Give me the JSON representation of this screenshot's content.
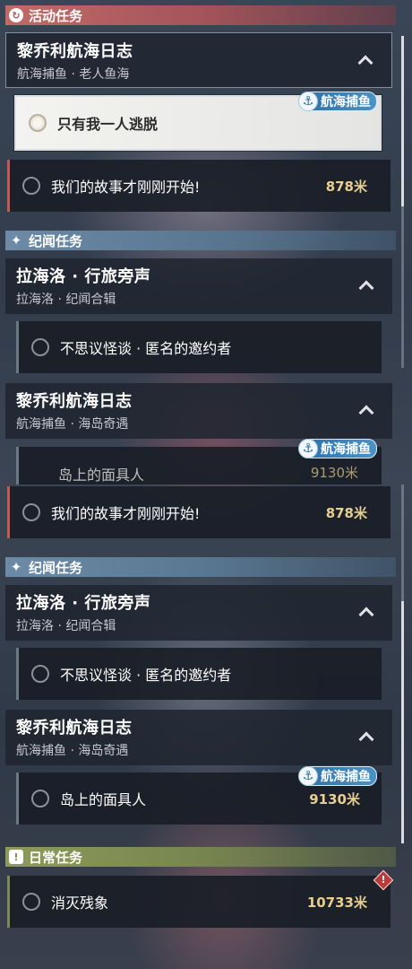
{
  "colors": {
    "activity_header": "#b0585a",
    "lore_header": "#5a7892",
    "daily_header": "#7d8b4e",
    "distance_text": "#e8cf8f",
    "badge_blue": "#3a82b8",
    "alert_red": "#b83c3c"
  },
  "panel_a": {
    "activity_header": {
      "label": "活动任务",
      "icon": "cycle-icon"
    },
    "activity_chapter": {
      "title": "黎乔利航海日志",
      "subtitle": "航海捕鱼 · 老人鱼海"
    },
    "selected_task": {
      "label": "只有我一人逃脱",
      "badge": "航海捕鱼"
    },
    "task_story": {
      "label": "我们的故事才刚刚开始!",
      "distance": "878米"
    },
    "lore_header": {
      "label": "纪闻任务",
      "icon": "sparkle-icon"
    },
    "lore_chapter_1": {
      "title": "拉海洛 · 行旅旁声",
      "subtitle": "拉海洛 · 纪闻合辑"
    },
    "task_inviter": {
      "label": "不思议怪谈 · 匿名的邀约者"
    },
    "lore_chapter_2": {
      "title": "黎乔利航海日志",
      "subtitle": "航海捕鱼 · 海岛奇遇"
    },
    "cut_task": {
      "label": "岛上的面具人",
      "distance": "9130米",
      "badge": "航海捕鱼"
    }
  },
  "panel_b": {
    "task_story": {
      "label": "我们的故事才刚刚开始!",
      "distance": "878米"
    },
    "lore_header": {
      "label": "纪闻任务",
      "icon": "sparkle-icon"
    },
    "lore_chapter_1": {
      "title": "拉海洛 · 行旅旁声",
      "subtitle": "拉海洛 · 纪闻合辑"
    },
    "task_inviter": {
      "label": "不思议怪谈 · 匿名的邀约者"
    },
    "lore_chapter_2": {
      "title": "黎乔利航海日志",
      "subtitle": "航海捕鱼 · 海岛奇遇"
    },
    "task_mask": {
      "label": "岛上的面具人",
      "distance": "9130米",
      "badge": "航海捕鱼"
    },
    "daily_header": {
      "label": "日常任务",
      "icon": "exclamation-icon"
    },
    "task_daily": {
      "label": "消灭残象",
      "distance": "10733米",
      "alert_icon": "!"
    }
  }
}
